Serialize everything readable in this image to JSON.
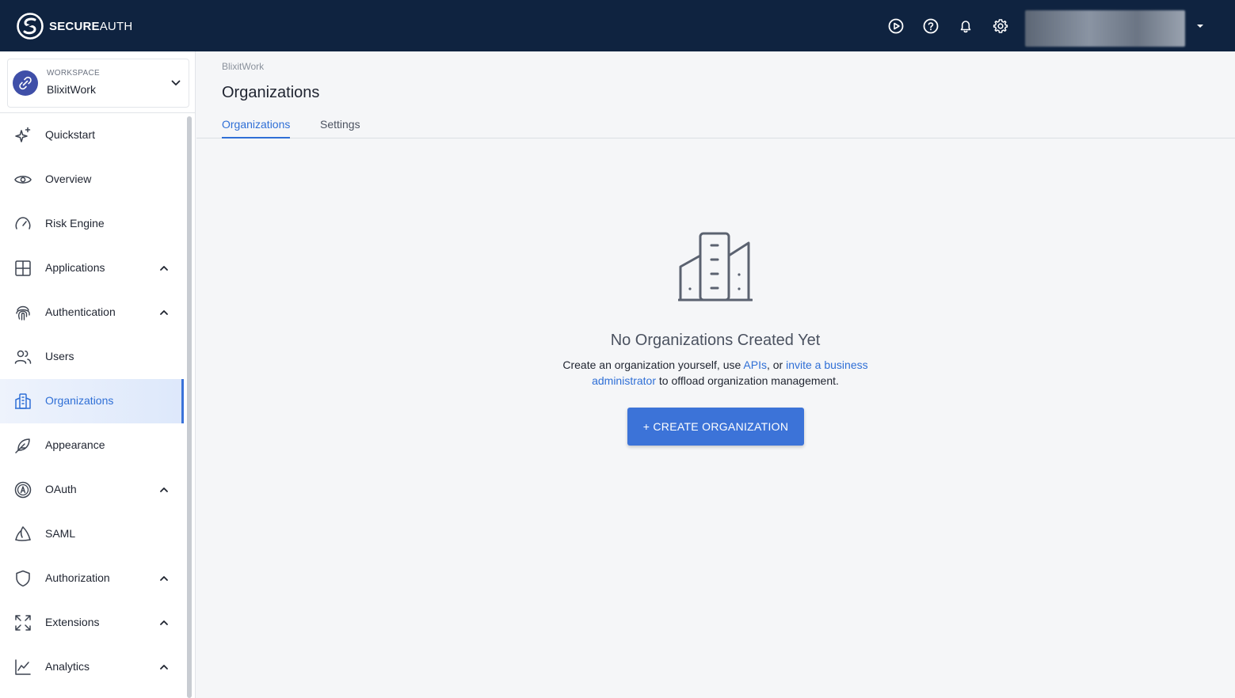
{
  "app": {
    "brand_bold": "SECURE",
    "brand_light": "AUTH"
  },
  "topbar": {
    "icons": [
      "play-circle-icon",
      "help-circle-icon",
      "bell-icon",
      "gear-icon"
    ],
    "user_menu_caret": "caret-down-icon"
  },
  "workspace": {
    "label": "WORKSPACE",
    "name": "BlixitWork"
  },
  "sidebar": {
    "items": [
      {
        "label": "Quickstart",
        "icon": "sparkles-icon",
        "chevron": false,
        "active": false
      },
      {
        "label": "Overview",
        "icon": "eye-icon",
        "chevron": false,
        "active": false
      },
      {
        "label": "Risk Engine",
        "icon": "gauge-icon",
        "chevron": false,
        "active": false
      },
      {
        "label": "Applications",
        "icon": "grid-icon",
        "chevron": true,
        "active": false
      },
      {
        "label": "Authentication",
        "icon": "fingerprint-icon",
        "chevron": true,
        "active": false
      },
      {
        "label": "Users",
        "icon": "users-icon",
        "chevron": false,
        "active": false
      },
      {
        "label": "Organizations",
        "icon": "buildings-icon",
        "chevron": false,
        "active": true
      },
      {
        "label": "Appearance",
        "icon": "feather-icon",
        "chevron": false,
        "active": false
      },
      {
        "label": "OAuth",
        "icon": "oauth-icon",
        "chevron": true,
        "active": false
      },
      {
        "label": "SAML",
        "icon": "saml-icon",
        "chevron": false,
        "active": false
      },
      {
        "label": "Authorization",
        "icon": "shield-icon",
        "chevron": true,
        "active": false
      },
      {
        "label": "Extensions",
        "icon": "expand-icon",
        "chevron": true,
        "active": false
      },
      {
        "label": "Analytics",
        "icon": "chart-line-icon",
        "chevron": true,
        "active": false
      }
    ]
  },
  "main": {
    "breadcrumb": "BlixitWork",
    "title": "Organizations",
    "tabs": [
      {
        "label": "Organizations",
        "active": true
      },
      {
        "label": "Settings",
        "active": false
      }
    ],
    "empty_state": {
      "icon": "buildings-icon",
      "title": "No Organizations Created Yet",
      "desc_part1": "Create an organization yourself, use ",
      "link_apis": "APIs",
      "desc_part2": ", or ",
      "link_invite": "invite a business administrator",
      "desc_part3": " to offload organization management.",
      "button": "+ CREATE ORGANIZATION"
    }
  },
  "colors": {
    "topbar": "#0f2340",
    "accent": "#3c73d8",
    "link": "#2f6fd6"
  }
}
